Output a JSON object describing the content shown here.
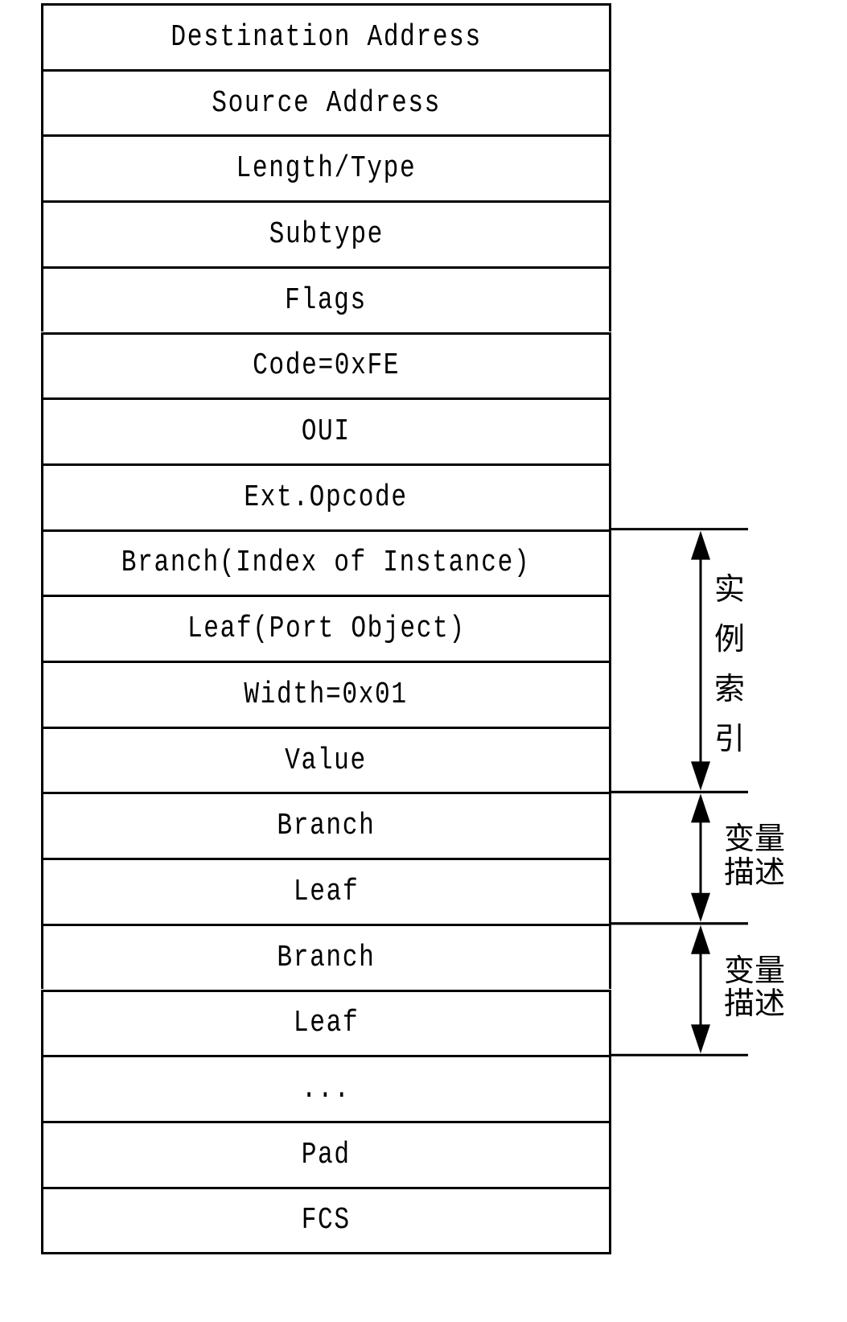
{
  "diagram": {
    "fields": [
      "Destination Address",
      "Source Address",
      "Length/Type",
      "Subtype",
      "Flags",
      "Code=0xFE",
      "OUI",
      "Ext.Opcode",
      "Branch(Index of Instance)",
      "Leaf(Port Object)",
      "Width=0x01",
      "Value",
      "Branch",
      "Leaf",
      "Branch",
      "Leaf",
      "...",
      "Pad",
      "FCS"
    ],
    "annotations": [
      {
        "label": "实例索引",
        "lines": [
          "实",
          "例",
          "索",
          "引"
        ],
        "from_field": 8,
        "to_field": 11
      },
      {
        "label": "变量描述",
        "lines": [
          "变量",
          "描述"
        ],
        "from_field": 12,
        "to_field": 13
      },
      {
        "label": "变量描述",
        "lines": [
          "变量",
          "描述"
        ],
        "from_field": 14,
        "to_field": 15
      }
    ]
  }
}
